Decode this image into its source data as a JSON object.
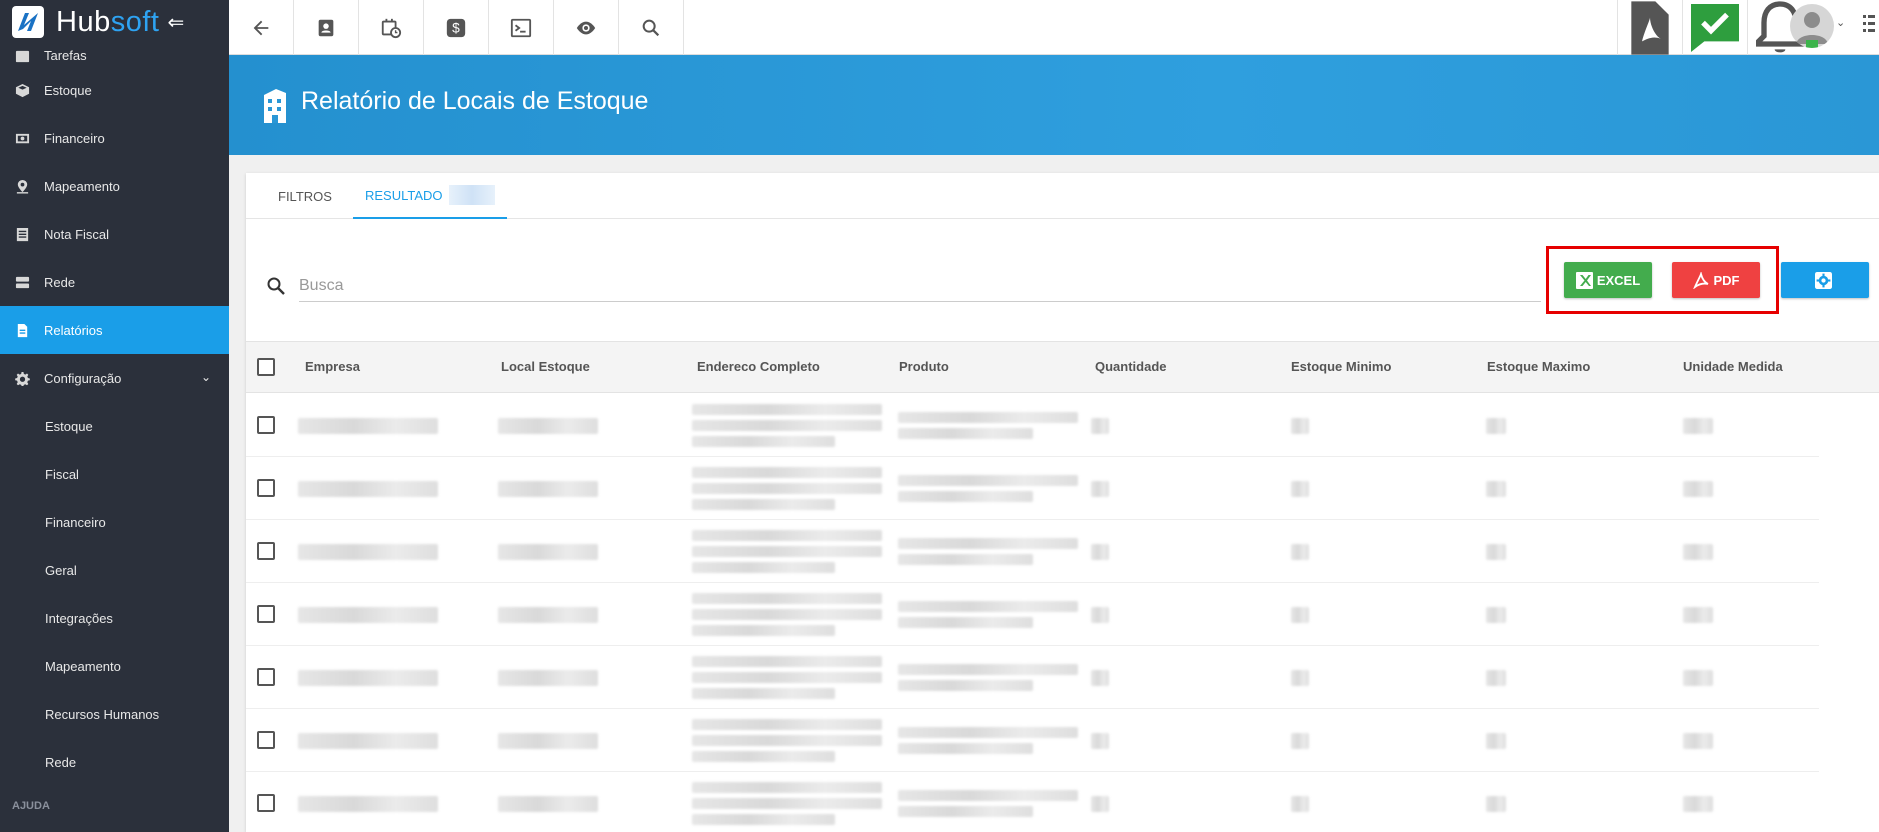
{
  "brand": {
    "name_a": "Hub",
    "name_b": "soft"
  },
  "sidebar": {
    "partial_item": "Tarefas",
    "items": [
      {
        "label": "Estoque",
        "icon": "box-icon"
      },
      {
        "label": "Financeiro",
        "icon": "money-icon"
      },
      {
        "label": "Mapeamento",
        "icon": "map-pin-icon"
      },
      {
        "label": "Nota Fiscal",
        "icon": "document-icon"
      },
      {
        "label": "Rede",
        "icon": "server-icon"
      },
      {
        "label": "Relatórios",
        "icon": "report-icon",
        "active": true
      },
      {
        "label": "Configuração",
        "icon": "gear-icon"
      }
    ],
    "sub_items": [
      "Estoque",
      "Fiscal",
      "Financeiro",
      "Geral",
      "Integrações",
      "Mapeamento",
      "Recursos Humanos",
      "Rede"
    ],
    "section": "AJUDA"
  },
  "topbar": {
    "icons": [
      "back-arrow-icon",
      "contact-icon",
      "calendar-clock-icon",
      "dollar-icon",
      "terminal-icon",
      "eye-icon",
      "search-icon"
    ],
    "right_icons": [
      "pdf-file-icon",
      "chat-check-icon",
      "bell-icon"
    ]
  },
  "page": {
    "title": "Relatório de Locais de Estoque"
  },
  "tabs": [
    {
      "label": "FILTROS",
      "active": false
    },
    {
      "label": "RESULTADO",
      "active": true
    }
  ],
  "search": {
    "placeholder": "Busca",
    "value": ""
  },
  "actions": {
    "excel": "EXCEL",
    "pdf": "PDF"
  },
  "table": {
    "columns": [
      "Empresa",
      "Local Estoque",
      "Endereco Completo",
      "Produto",
      "Quantidade",
      "Estoque Minimo",
      "Estoque Maximo",
      "Unidade Medida"
    ],
    "row_count": 7
  },
  "colors": {
    "sidebar": "#2b303b",
    "accent": "#1a9ee8",
    "excel": "#43ac4d",
    "pdf": "#ef4141",
    "highlight": "#e60000"
  }
}
